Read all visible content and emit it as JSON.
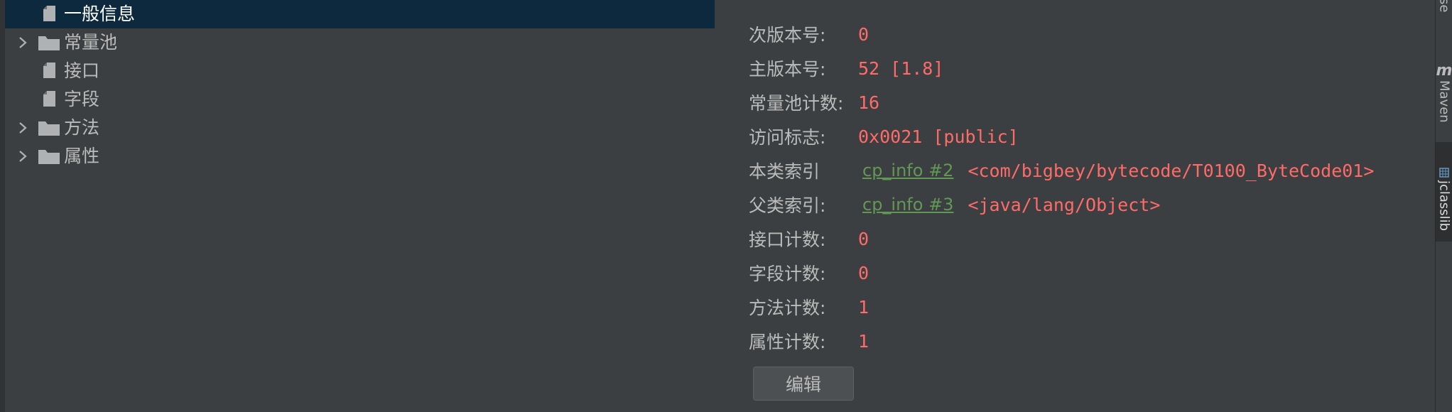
{
  "tree": {
    "items": [
      {
        "label": "一般信息",
        "type": "file",
        "expandable": false,
        "selected": true
      },
      {
        "label": "常量池",
        "type": "folder",
        "expandable": true,
        "selected": false
      },
      {
        "label": "接口",
        "type": "file",
        "expandable": false,
        "selected": false
      },
      {
        "label": "字段",
        "type": "file",
        "expandable": false,
        "selected": false
      },
      {
        "label": "方法",
        "type": "folder",
        "expandable": true,
        "selected": false
      },
      {
        "label": "属性",
        "type": "folder",
        "expandable": true,
        "selected": false
      }
    ]
  },
  "info": {
    "minor_version": {
      "label": "次版本号:",
      "value": "0"
    },
    "major_version": {
      "label": "主版本号:",
      "value": "52 [1.8]"
    },
    "constant_pool_count": {
      "label": "常量池计数:",
      "value": "16"
    },
    "access_flags": {
      "label": "访问标志:",
      "value": "0x0021 [public]"
    },
    "this_class": {
      "label": "本类索引",
      "link": "cp_info #2",
      "value": "<com/bigbey/bytecode/T0100_ByteCode01>"
    },
    "super_class": {
      "label": "父类索引:",
      "link": "cp_info #3",
      "value": "<java/lang/Object>"
    },
    "interfaces_count": {
      "label": "接口计数:",
      "value": "0"
    },
    "fields_count": {
      "label": "字段计数:",
      "value": "0"
    },
    "methods_count": {
      "label": "方法计数:",
      "value": "1"
    },
    "attributes_count": {
      "label": "属性计数:",
      "value": "1"
    }
  },
  "edit_button": {
    "label": "编辑"
  },
  "tool_window": {
    "database_label": "ase",
    "maven_icon": "m",
    "maven_label": "Maven",
    "jclasslib_label": "jclasslib"
  },
  "icons": {
    "file": "file-icon",
    "folder": "folder-icon",
    "chevron": "chevron-right-icon",
    "maven": "maven-icon",
    "jclasslib": "jclasslib-icon"
  },
  "colors": {
    "background": "#3c3f41",
    "selection": "#0d293e",
    "value_red": "#ff6b68",
    "link_green": "#629755",
    "text": "#bbbbbb",
    "icon": "#afb1b3"
  }
}
